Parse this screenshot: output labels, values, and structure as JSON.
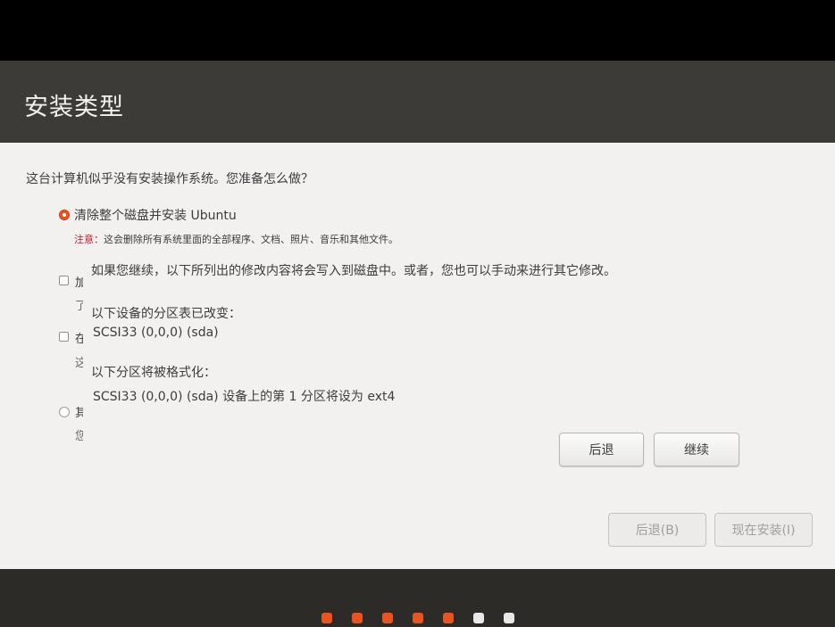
{
  "header": {
    "title": "安装类型"
  },
  "main": {
    "question": "这台计算机似乎没有安装操作系统。您准备怎么做？",
    "option_erase": {
      "label": "清除整个磁盘并安装 Ubuntu",
      "warning_prefix": "注意：",
      "warning_text": "这会删除所有系统里面的全部程序、文档、照片、音乐和其他文件。"
    },
    "hidden_option_glyphs": [
      "加",
      "了",
      "在",
      "这",
      "其",
      "您"
    ],
    "buttons": {
      "back": "后退(B)",
      "install_now": "现在安装(I)"
    }
  },
  "dialog": {
    "intro": "如果您继续，以下所列出的修改内容将会写入到磁盘中。或者，您也可以手动来进行其它修改。",
    "partition_tables_heading": "以下设备的分区表已改变：",
    "partition_tables_device": "SCSI33 (0,0,0) (sda)",
    "format_heading": "以下分区将被格式化：",
    "format_item": "SCSI33 (0,0,0) (sda) 设备上的第 1 分区将设为 ext4",
    "back_button": "后退",
    "continue_button": "继续"
  },
  "progress": {
    "total_steps": 7,
    "completed_steps": 5,
    "active_color": "#e95420",
    "inactive_color": "#e8e8e8"
  }
}
